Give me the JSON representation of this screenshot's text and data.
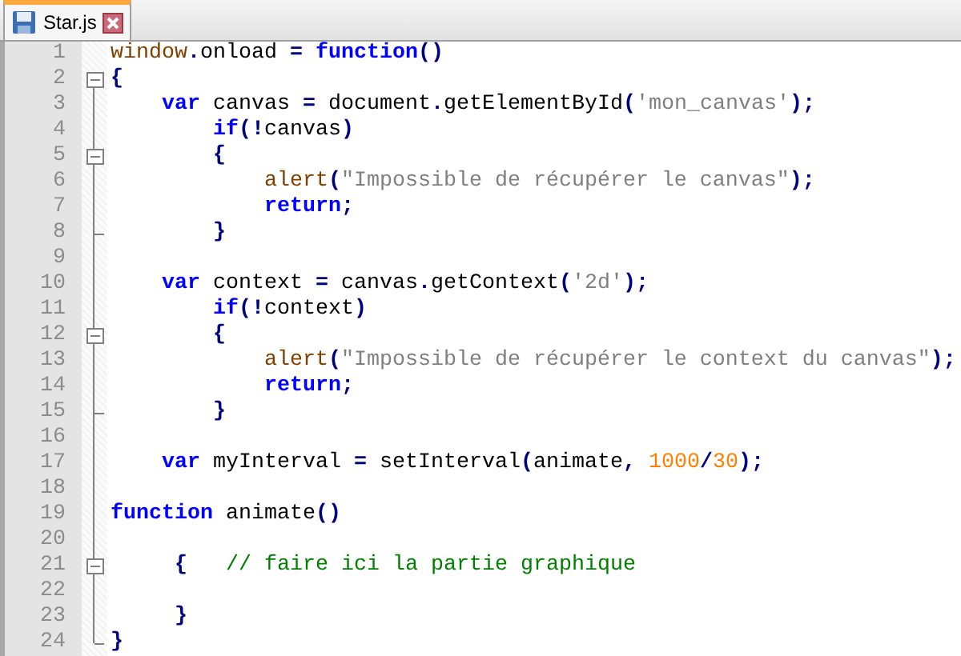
{
  "tabs": [
    {
      "label": "Star.js",
      "selected": true
    }
  ],
  "editor": {
    "lines": [
      {
        "number": "1",
        "fold_open": false,
        "fold_close": false,
        "tokens": [
          {
            "kind": "builtin",
            "text": "window"
          },
          {
            "kind": "op",
            "text": "."
          },
          {
            "kind": "plain",
            "text": "onload "
          },
          {
            "kind": "op",
            "text": "="
          },
          {
            "kind": "keyword",
            "text": " function"
          },
          {
            "kind": "op",
            "text": "()"
          }
        ]
      },
      {
        "number": "2",
        "fold_open": true,
        "fold_close": false,
        "tokens": [
          {
            "kind": "op",
            "text": "{"
          }
        ]
      },
      {
        "number": "3",
        "fold_open": false,
        "fold_close": false,
        "tokens": [
          {
            "kind": "keyword",
            "text": "    var"
          },
          {
            "kind": "plain",
            "text": " canvas "
          },
          {
            "kind": "op",
            "text": "="
          },
          {
            "kind": "plain",
            "text": " document"
          },
          {
            "kind": "op",
            "text": "."
          },
          {
            "kind": "plain",
            "text": "getElementById"
          },
          {
            "kind": "op",
            "text": "("
          },
          {
            "kind": "string",
            "text": "'mon_canvas'"
          },
          {
            "kind": "op",
            "text": ");"
          }
        ]
      },
      {
        "number": "4",
        "fold_open": false,
        "fold_close": false,
        "tokens": [
          {
            "kind": "keyword",
            "text": "        if"
          },
          {
            "kind": "op",
            "text": "(!"
          },
          {
            "kind": "plain",
            "text": "canvas"
          },
          {
            "kind": "op",
            "text": ")"
          }
        ]
      },
      {
        "number": "5",
        "fold_open": true,
        "fold_close": false,
        "tokens": [
          {
            "kind": "op",
            "text": "        {"
          }
        ]
      },
      {
        "number": "6",
        "fold_open": false,
        "fold_close": false,
        "tokens": [
          {
            "kind": "builtin",
            "text": "            alert"
          },
          {
            "kind": "op",
            "text": "("
          },
          {
            "kind": "string",
            "text": "\"Impossible de récupérer le canvas\""
          },
          {
            "kind": "op",
            "text": ");"
          }
        ]
      },
      {
        "number": "7",
        "fold_open": false,
        "fold_close": false,
        "tokens": [
          {
            "kind": "keyword",
            "text": "            return"
          },
          {
            "kind": "op",
            "text": ";"
          }
        ]
      },
      {
        "number": "8",
        "fold_open": false,
        "fold_close": true,
        "tokens": [
          {
            "kind": "op",
            "text": "        }"
          }
        ]
      },
      {
        "number": "9",
        "fold_open": false,
        "fold_close": false
      },
      {
        "number": "10",
        "fold_open": false,
        "fold_close": false,
        "tokens": [
          {
            "kind": "keyword",
            "text": "    var"
          },
          {
            "kind": "plain",
            "text": " context "
          },
          {
            "kind": "op",
            "text": "="
          },
          {
            "kind": "plain",
            "text": " canvas"
          },
          {
            "kind": "op",
            "text": "."
          },
          {
            "kind": "plain",
            "text": "getContext"
          },
          {
            "kind": "op",
            "text": "("
          },
          {
            "kind": "string",
            "text": "'2d'"
          },
          {
            "kind": "op",
            "text": ");"
          }
        ]
      },
      {
        "number": "11",
        "fold_open": false,
        "fold_close": false,
        "tokens": [
          {
            "kind": "keyword",
            "text": "        if"
          },
          {
            "kind": "op",
            "text": "(!"
          },
          {
            "kind": "plain",
            "text": "context"
          },
          {
            "kind": "op",
            "text": ")"
          }
        ]
      },
      {
        "number": "12",
        "fold_open": true,
        "fold_close": false,
        "tokens": [
          {
            "kind": "op",
            "text": "        {"
          }
        ]
      },
      {
        "number": "13",
        "fold_open": false,
        "fold_close": false,
        "tokens": [
          {
            "kind": "builtin",
            "text": "            alert"
          },
          {
            "kind": "op",
            "text": "("
          },
          {
            "kind": "string",
            "text": "\"Impossible de récupérer le context du canvas\""
          },
          {
            "kind": "op",
            "text": ");"
          }
        ]
      },
      {
        "number": "14",
        "fold_open": false,
        "fold_close": false,
        "tokens": [
          {
            "kind": "keyword",
            "text": "            return"
          },
          {
            "kind": "op",
            "text": ";"
          }
        ]
      },
      {
        "number": "15",
        "fold_open": false,
        "fold_close": true,
        "tokens": [
          {
            "kind": "op",
            "text": "        }"
          }
        ]
      },
      {
        "number": "16",
        "fold_open": false,
        "fold_close": false
      },
      {
        "number": "17",
        "fold_open": false,
        "fold_close": false,
        "tokens": [
          {
            "kind": "keyword",
            "text": "    var"
          },
          {
            "kind": "plain",
            "text": " myInterval "
          },
          {
            "kind": "op",
            "text": "="
          },
          {
            "kind": "plain",
            "text": " setInterval"
          },
          {
            "kind": "op",
            "text": "("
          },
          {
            "kind": "plain",
            "text": "animate"
          },
          {
            "kind": "op",
            "text": ","
          },
          {
            "kind": "number",
            "text": " 1000"
          },
          {
            "kind": "op",
            "text": "/"
          },
          {
            "kind": "number",
            "text": "30"
          },
          {
            "kind": "op",
            "text": ");"
          }
        ]
      },
      {
        "number": "18",
        "fold_open": false,
        "fold_close": false
      },
      {
        "number": "19",
        "fold_open": false,
        "fold_close": false,
        "tokens": [
          {
            "kind": "keyword",
            "text": "function"
          },
          {
            "kind": "plain",
            "text": " animate"
          },
          {
            "kind": "op",
            "text": "()"
          }
        ]
      },
      {
        "number": "20",
        "fold_open": false,
        "fold_close": false
      },
      {
        "number": "21",
        "fold_open": true,
        "fold_close": false,
        "tokens": [
          {
            "kind": "op",
            "text": "     {"
          },
          {
            "kind": "comment",
            "text": "   // faire ici la partie graphique"
          }
        ]
      },
      {
        "number": "22",
        "fold_open": false,
        "fold_close": false
      },
      {
        "number": "23",
        "fold_open": false,
        "fold_close": false,
        "tokens": [
          {
            "kind": "op",
            "text": "     }"
          }
        ]
      },
      {
        "number": "24",
        "fold_open": false,
        "fold_close": true,
        "tokens": [
          {
            "kind": "op",
            "text": "}"
          }
        ]
      }
    ]
  }
}
